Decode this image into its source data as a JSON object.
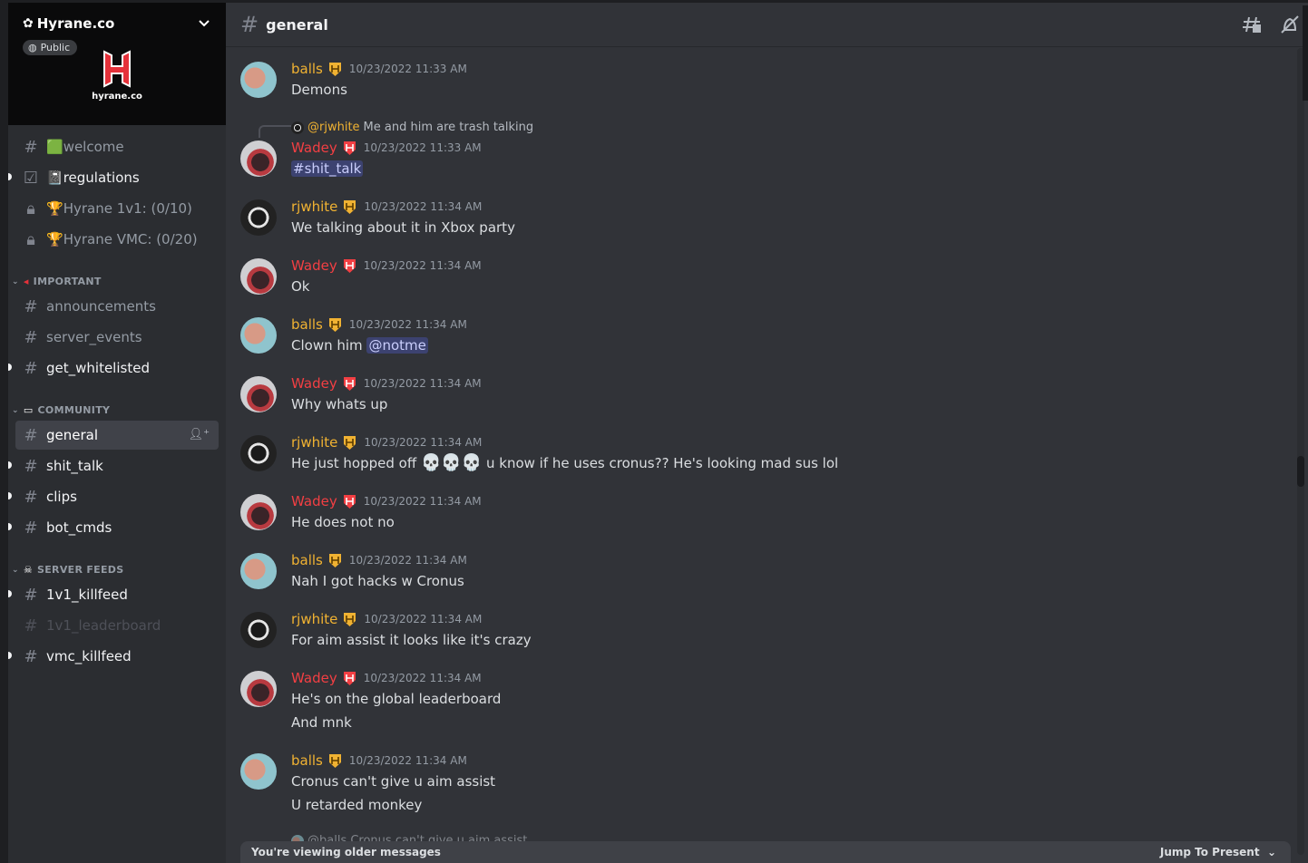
{
  "server": {
    "name": "Hyrane.co",
    "badge": "Public",
    "logo_text": "hyrane.co"
  },
  "channels_top": [
    {
      "name": "welcome",
      "emoji": "🟩",
      "style": "normal",
      "icon": "hash"
    },
    {
      "name": "regulations",
      "emoji": "📓",
      "style": "bright",
      "icon": "checkbox",
      "unread": true
    },
    {
      "name": "Hyrane 1v1: (0/10)",
      "emoji": "🏆",
      "style": "normal",
      "icon": "lock"
    },
    {
      "name": "Hyrane VMC: (0/20)",
      "emoji": "🏆",
      "style": "normal",
      "icon": "lock"
    }
  ],
  "categories": {
    "important": "IMPORTANT",
    "community": "COMMUNITY",
    "server_feeds": "SERVER FEEDS"
  },
  "channels_important": [
    {
      "name": "announcements"
    },
    {
      "name": "server_events"
    },
    {
      "name": "get_whitelisted"
    }
  ],
  "channels_community": [
    {
      "name": "general"
    },
    {
      "name": "shit_talk"
    },
    {
      "name": "clips"
    },
    {
      "name": "bot_cmds"
    }
  ],
  "channels_feeds": [
    {
      "name": "1v1_killfeed"
    },
    {
      "name": "1v1_leaderboard"
    },
    {
      "name": "vmc_killfeed"
    }
  ],
  "header": {
    "channel": "general"
  },
  "messages": [
    {
      "author": "balls",
      "color": "gold",
      "time": "10/23/2022 11:33 AM",
      "lines": [
        "Demons"
      ]
    },
    {
      "reply_to": "@rjwhite",
      "reply_text": "Me and him are trash talking",
      "author": "Wadey",
      "color": "red",
      "time": "10/23/2022 11:33 AM",
      "channel_mention": "#shit_talk"
    },
    {
      "author": "rjwhite",
      "color": "gold",
      "time": "10/23/2022 11:34 AM",
      "lines": [
        "We talking about it in Xbox party"
      ]
    },
    {
      "author": "Wadey",
      "color": "red",
      "time": "10/23/2022 11:34 AM",
      "lines": [
        "Ok"
      ]
    },
    {
      "author": "balls",
      "color": "gold",
      "time": "10/23/2022 11:34 AM",
      "text": "Clown him",
      "mention": "@notme"
    },
    {
      "author": "Wadey",
      "color": "red",
      "time": "10/23/2022 11:34 AM",
      "lines": [
        "Why whats up"
      ]
    },
    {
      "author": "rjwhite",
      "color": "gold",
      "time": "10/23/2022 11:34 AM",
      "text_a": "He just hopped off",
      "skulls": "💀💀💀",
      "text_b": "u know if he uses cronus?? He's looking mad sus lol"
    },
    {
      "author": "Wadey",
      "color": "red",
      "time": "10/23/2022 11:34 AM",
      "lines": [
        "He does not no"
      ]
    },
    {
      "author": "balls",
      "color": "gold",
      "time": "10/23/2022 11:34 AM",
      "lines": [
        "Nah I got hacks w Cronus"
      ]
    },
    {
      "author": "rjwhite",
      "color": "gold",
      "time": "10/23/2022 11:34 AM",
      "lines": [
        "For aim assist it looks like it's crazy"
      ]
    },
    {
      "author": "Wadey",
      "color": "red",
      "time": "10/23/2022 11:34 AM",
      "lines": [
        "He's on the global leaderboard",
        "And mnk"
      ]
    },
    {
      "author": "balls",
      "color": "gold",
      "time": "10/23/2022 11:34 AM",
      "lines": [
        "Cronus can't give u aim assist",
        "U retarded monkey"
      ]
    }
  ],
  "partial_reply": "@balls Cronus can't give u aim assist",
  "older_bar": {
    "left": "You're viewing older messages",
    "right": "Jump To Present"
  },
  "colors": {
    "gold": "#f0b232",
    "red": "#f23f43",
    "background": "#313338",
    "sidebar": "#2b2d31"
  }
}
